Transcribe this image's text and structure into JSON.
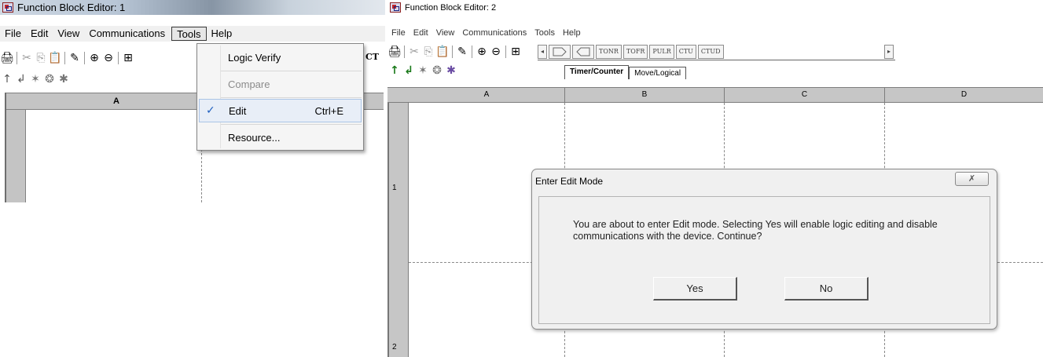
{
  "left_window": {
    "title": "Function Block Editor: 1",
    "menu": [
      "File",
      "Edit",
      "View",
      "Communications",
      "Tools",
      "Help"
    ],
    "active_menu": "Tools",
    "column_header": "A",
    "toolbar_edge_text": "CT",
    "tools_menu": {
      "items": [
        {
          "label": "Logic Verify",
          "shortcut": "",
          "checked": false,
          "disabled": false
        },
        {
          "label": "Compare",
          "shortcut": "",
          "checked": false,
          "disabled": true
        },
        {
          "label": "Edit",
          "shortcut": "Ctrl+E",
          "checked": true,
          "disabled": false
        },
        {
          "label": "Resource...",
          "shortcut": "",
          "checked": false,
          "disabled": false
        }
      ]
    }
  },
  "right_window": {
    "title": "Function Block Editor: 2",
    "menu": [
      "File",
      "Edit",
      "View",
      "Communications",
      "Tools",
      "Help"
    ],
    "function_blocks": [
      "TONR",
      "TOFR",
      "PULR",
      "CTU",
      "CTUD"
    ],
    "tabs": [
      "Timer/Counter",
      "Move/Logical"
    ],
    "active_tab": "Timer/Counter",
    "columns": [
      "A",
      "B",
      "C",
      "D"
    ],
    "rows": [
      "1",
      "2"
    ]
  },
  "dialog": {
    "title": "Enter Edit Mode",
    "close_glyph": "✗",
    "message": "You are about to enter Edit mode.  Selecting Yes will enable logic editing and disable communications with the device.  Continue?",
    "yes_label": "Yes",
    "no_label": "No"
  },
  "icons": {
    "print": "🖨",
    "cut": "✂",
    "copy": "⎘",
    "paste": "📋",
    "properties": "✎",
    "zoom_in": "⊕",
    "zoom_out": "⊖",
    "lock": "⊞",
    "up": "↑",
    "down": "↲",
    "tool_a": "✶",
    "tool_b": "❂",
    "tool_c": "✱",
    "arrow_left": "◂",
    "arrow_right": "▸"
  }
}
